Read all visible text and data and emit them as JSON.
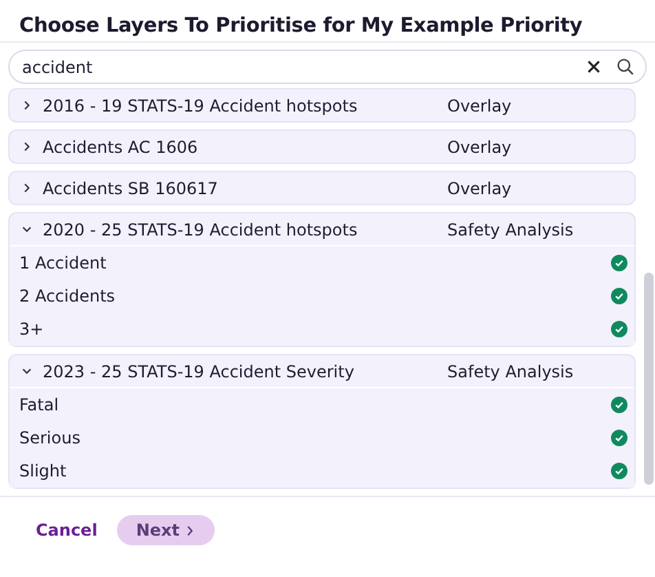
{
  "title": "Choose Layers To Prioritise for My Example Priority",
  "search": {
    "value": "accident"
  },
  "layers": [
    {
      "name": "2016 - 19 STATS-19 Accident hotspots",
      "type": "Overlay",
      "expanded": false
    },
    {
      "name": "Accidents AC 1606",
      "type": "Overlay",
      "expanded": false
    },
    {
      "name": "Accidents SB 160617",
      "type": "Overlay",
      "expanded": false
    },
    {
      "name": "2020 - 25 STATS-19 Accident hotspots",
      "type": "Safety Analysis",
      "expanded": true,
      "children": [
        {
          "label": "1 Accident",
          "checked": true
        },
        {
          "label": "2 Accidents",
          "checked": true
        },
        {
          "label": "3+",
          "checked": true
        }
      ]
    },
    {
      "name": "2023 - 25 STATS-19 Accident Severity",
      "type": "Safety Analysis",
      "expanded": true,
      "children": [
        {
          "label": "Fatal",
          "checked": true
        },
        {
          "label": "Serious",
          "checked": true
        },
        {
          "label": "Slight",
          "checked": true
        }
      ]
    }
  ],
  "buttons": {
    "cancel": "Cancel",
    "next": "Next"
  }
}
